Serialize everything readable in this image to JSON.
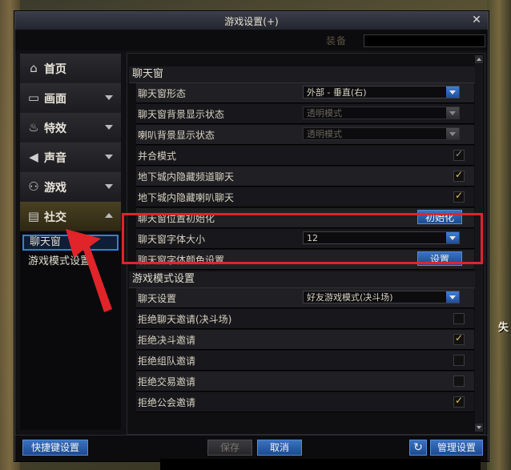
{
  "window": {
    "title": "游戏设置(+)",
    "close_icon": "close-icon",
    "faded_text": "装备"
  },
  "sidebar": {
    "items": [
      {
        "label": "首页",
        "icon": "home-icon",
        "glyph": "⌂",
        "expandable": false
      },
      {
        "label": "画面",
        "icon": "monitor-icon",
        "glyph": "▭",
        "expandable": true
      },
      {
        "label": "特效",
        "icon": "flame-icon",
        "glyph": "♨",
        "expandable": true
      },
      {
        "label": "声音",
        "icon": "speaker-icon",
        "glyph": "◀",
        "expandable": true
      },
      {
        "label": "游戏",
        "icon": "gamepad-icon",
        "glyph": "⚇",
        "expandable": true
      },
      {
        "label": "社交",
        "icon": "chat-icon",
        "glyph": "▤",
        "expandable": true,
        "expanded": true
      }
    ],
    "sub_items": [
      {
        "label": "聊天窗",
        "selected": true
      },
      {
        "label": "游戏模式设置",
        "selected": false
      }
    ]
  },
  "sections": {
    "chat_window": {
      "title": "聊天窗",
      "rows": [
        {
          "label": "聊天窗形态",
          "control": "dropdown",
          "value": "外部 - 垂直(右)",
          "enabled": true
        },
        {
          "label": "聊天窗背景显示状态",
          "control": "dropdown",
          "value": "透明模式",
          "enabled": false
        },
        {
          "label": "喇叭背景显示状态",
          "control": "dropdown",
          "value": "透明模式",
          "enabled": false
        },
        {
          "label": "并合模式",
          "control": "checkbox",
          "checked": true,
          "enabled": false
        },
        {
          "label": "地下城内隐藏频道聊天",
          "control": "checkbox",
          "checked": true,
          "enabled": true
        },
        {
          "label": "地下城内隐藏喇叭聊天",
          "control": "checkbox",
          "checked": true,
          "enabled": true
        },
        {
          "label": "聊天窗位置初始化",
          "control": "button",
          "button_label": "初始化"
        },
        {
          "label": "聊天窗字体大小",
          "control": "dropdown",
          "value": "12",
          "enabled": true
        },
        {
          "label": "聊天窗字体颜色设置",
          "control": "button",
          "button_label": "设置"
        }
      ]
    },
    "game_mode": {
      "title": "游戏模式设置",
      "rows": [
        {
          "label": "聊天设置",
          "control": "dropdown",
          "value": "好友游戏模式(决斗场)",
          "enabled": true
        },
        {
          "label": "拒绝聊天邀请(决斗场)",
          "control": "checkbox",
          "checked": false,
          "enabled": true
        },
        {
          "label": "拒绝决斗邀请",
          "control": "checkbox",
          "checked": true,
          "enabled": true
        },
        {
          "label": "拒绝组队邀请",
          "control": "checkbox",
          "checked": false,
          "enabled": true
        },
        {
          "label": "拒绝交易邀请",
          "control": "checkbox",
          "checked": false,
          "enabled": true
        },
        {
          "label": "拒绝公会邀请",
          "control": "checkbox",
          "checked": true,
          "enabled": true
        }
      ]
    }
  },
  "footer": {
    "shortcut": "快捷键设置",
    "save": "保存",
    "cancel": "取消",
    "reset_icon": "refresh-icon",
    "manage": "管理设置"
  },
  "accent_colors": {
    "highlight": "#e0242a",
    "selection": "#2f80d8",
    "check": "#e5c060"
  },
  "background_text": "失"
}
